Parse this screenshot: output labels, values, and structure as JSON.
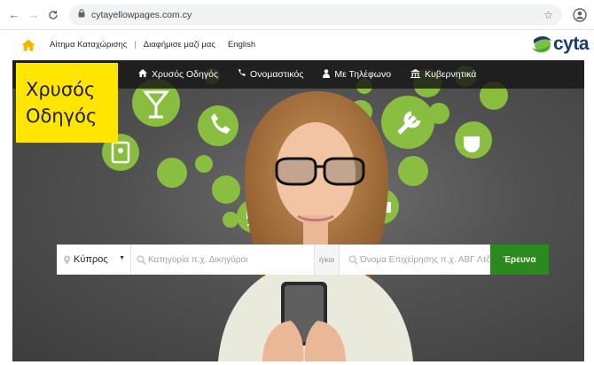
{
  "browser": {
    "back_icon": "back-arrow-icon",
    "forward_icon": "forward-arrow-icon",
    "reload_icon": "reload-icon",
    "url": "cytayellowpages.com.cy",
    "bookmark_icon": "star-icon",
    "profile_icon": "account-icon"
  },
  "topbar": {
    "home_icon": "home-icon",
    "links": [
      "Αίτημα Καταχώρισης",
      "Διαφήμισε μαζί μας",
      "English"
    ],
    "separator": "|",
    "brand": "cyta"
  },
  "logo": {
    "line1": "Χρυσός",
    "line2": "Οδηγός"
  },
  "nav": {
    "items": [
      {
        "label": "Χρυσός Οδηγός",
        "icon": "home-icon"
      },
      {
        "label": "Ονομαστικός",
        "icon": "phone-icon"
      },
      {
        "label": "Με Τηλέφωνο",
        "icon": "person-icon"
      },
      {
        "label": "Κυβερνητικά",
        "icon": "government-icon"
      }
    ]
  },
  "search": {
    "location_value": "Κύπρος",
    "category_placeholder": "Κατηγορία π.χ. Δικηγόροι",
    "or_label": "ή/και",
    "name_placeholder": "Όνομα Επιχείρησης π.χ. ΑΒΓ Λτδ",
    "button_label": "Έρευνα"
  },
  "colors": {
    "accent_yellow": "#ffe600",
    "search_green": "#2b8a1e",
    "icon_green": "#8dc63f",
    "cyta_navy": "#1b3a6b"
  }
}
